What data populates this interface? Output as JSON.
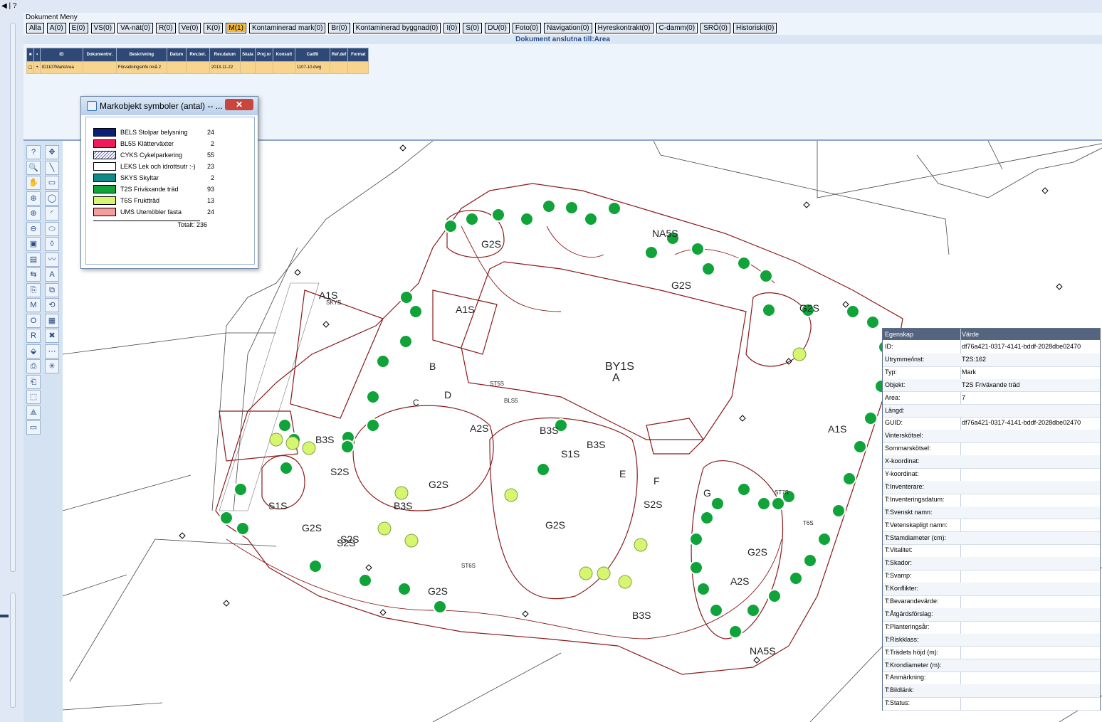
{
  "menu": {
    "topbar_glyph": "◀ | ?",
    "title": "Dokument Meny",
    "chips": [
      "Alla",
      "A(0)",
      "E(0)",
      "VS(0)",
      "VA-nät(0)",
      "R(0)",
      "Ve(0)",
      "K(0)",
      "M(1)",
      "Kontaminerad mark(0)",
      "Br(0)",
      "Kontaminerad byggnad(0)",
      "I(0)",
      "S(0)",
      "DU(0)",
      "Foto(0)",
      "Navigation(0)",
      "Hyreskontrakt(0)",
      "C-damm(0)",
      "SRÖ(0)",
      "Historiskt(0)"
    ],
    "active_chip": "M(1)",
    "subtitle": "Dokument anslutna till:Area"
  },
  "doc_table": {
    "headers": [
      "ID",
      "Dokumentnr.",
      "Beskrivning",
      "Datum",
      "Rev.bet.",
      "Rev.datum",
      "Skala",
      "Proj.nr",
      "Konsult",
      "Cadfil",
      "Ref.def",
      "Format"
    ],
    "row": [
      "ID1107MarkArea",
      "",
      "Förvaltningsinfo nivå 2",
      "",
      "",
      "2013-11-22",
      "",
      "",
      "",
      "1107-10.dwg",
      "",
      ""
    ]
  },
  "legend": {
    "title": "Markobjekt symboler (antal) -- ...",
    "close": "✕",
    "items": [
      {
        "label": "BELS Stolpar belysning",
        "count": "24",
        "color": "#0b1f7a"
      },
      {
        "label": "BL5S Klätterväxter",
        "count": "2",
        "color": "#ee1a5c"
      },
      {
        "label": "CYKS Cykelparkering",
        "count": "55",
        "color": "#ffffff"
      },
      {
        "label": "LEKS Lek och idrottsutr :-)",
        "count": "23",
        "color": "#ffffff"
      },
      {
        "label": "SKYS Skyltar",
        "count": "2",
        "color": "#0e8a8a"
      },
      {
        "label": "T2S Friväxande träd",
        "count": "93",
        "color": "#0fa33a"
      },
      {
        "label": "T6S Fruktträd",
        "count": "13",
        "color": "#d7f56f"
      },
      {
        "label": "UMS Utemöbler fasta",
        "count": "24",
        "color": "#f69c9c"
      }
    ],
    "total": "Totalt:  236"
  },
  "properties": {
    "header_key": "Egenskap",
    "header_value": "Värde",
    "rows": [
      {
        "k": "ID:",
        "v": "df76a421-0317-4141-bddf-2028dbe02470"
      },
      {
        "k": "Utrymme/inst:",
        "v": "T2S:162"
      },
      {
        "k": "Typ:",
        "v": "Mark"
      },
      {
        "k": "Objekt:",
        "v": "T2S Friväxande träd"
      },
      {
        "k": "Area:",
        "v": "7"
      },
      {
        "k": "Längd:",
        "v": ""
      },
      {
        "k": "GUID:",
        "v": "df76a421-0317-4141-bddf-2028dbe02470"
      },
      {
        "k": "Vinterskötsel:",
        "v": ""
      },
      {
        "k": "Sommarskötsel:",
        "v": ""
      },
      {
        "k": "X-koordinat:",
        "v": ""
      },
      {
        "k": "Y-koordinat:",
        "v": ""
      },
      {
        "k": "T:Inventerare:",
        "v": ""
      },
      {
        "k": "T:Inventeringsdatum:",
        "v": ""
      },
      {
        "k": "T:Svenskt namn:",
        "v": ""
      },
      {
        "k": "T:Vetenskapligt namn:",
        "v": ""
      },
      {
        "k": "T:Stamdiameter (cm):",
        "v": ""
      },
      {
        "k": "T:Vitalitet:",
        "v": ""
      },
      {
        "k": "T:Skador:",
        "v": ""
      },
      {
        "k": "T:Svamp:",
        "v": ""
      },
      {
        "k": "T:Konflikter:",
        "v": ""
      },
      {
        "k": "T:Bevarandevärde:",
        "v": ""
      },
      {
        "k": "T:Åtgärdsförslag:",
        "v": ""
      },
      {
        "k": "T:Planteringsår:",
        "v": ""
      },
      {
        "k": "T:Riskklass:",
        "v": ""
      },
      {
        "k": "T:Trädets höjd (m):",
        "v": ""
      },
      {
        "k": "T:Krondiameter (m):",
        "v": ""
      },
      {
        "k": "T:Anmärkning:",
        "v": ""
      },
      {
        "k": "T:Bildlänk:",
        "v": ""
      },
      {
        "k": "T:Status:",
        "v": ""
      }
    ]
  },
  "map": {
    "labels": [
      "G2S",
      "A1S",
      "BY1S",
      "A",
      "B3S",
      "S1S",
      "S2S",
      "A2S",
      "NA5S",
      "B",
      "D",
      "E",
      "F",
      "G",
      "C",
      "ST6S",
      "ST5S",
      "ST7S",
      "SKYS",
      "T6S",
      "BLS5",
      "B3S",
      "S2S",
      "G2S",
      "A1S",
      "G2S",
      "G2S",
      "S1S",
      "B3S",
      "G2S",
      "A2S",
      "NA5S",
      "G2S",
      "S2S",
      "G2S",
      "A1S",
      "B3S",
      "G2S",
      "S2S",
      "B3S"
    ],
    "tree_color": "#0fa33a",
    "fruit_color": "#d7f56f",
    "outline_color": "#8b1a1a"
  },
  "toolbar": {
    "tools": [
      "?",
      "✥",
      "🔍",
      "╲",
      "✋",
      "▭",
      "⊕",
      "◯",
      "⊕",
      "◜",
      "⊖",
      "⬭",
      "▣",
      "◊",
      "▤",
      "〰",
      "⇆",
      "A",
      "⎘",
      "⧉",
      "M",
      "⟲",
      "O",
      "▦",
      "R",
      "✖",
      "⬙",
      "⋯",
      "⎙",
      "✳",
      "⎗",
      "",
      "⬚",
      "",
      "⟁",
      "",
      "▭",
      ""
    ]
  }
}
